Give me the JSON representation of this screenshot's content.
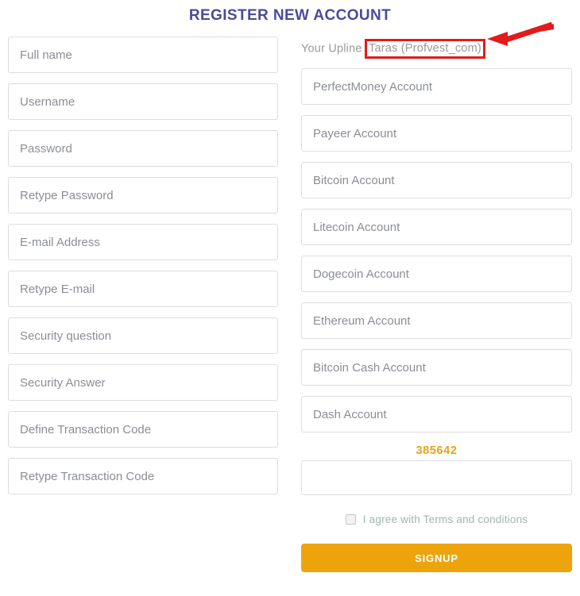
{
  "page": {
    "title": "REGISTER NEW ACCOUNT"
  },
  "upline": {
    "label": "Your Upline",
    "value": "Taras (Profvest_com)"
  },
  "annotation": {
    "arrow_color": "#e21b1b",
    "highlight_box_color": "#e21b1b"
  },
  "personal_fields": [
    {
      "name": "full-name",
      "placeholder": "Full name",
      "value": ""
    },
    {
      "name": "username",
      "placeholder": "Username",
      "value": ""
    },
    {
      "name": "password",
      "placeholder": "Password",
      "value": ""
    },
    {
      "name": "retype-password",
      "placeholder": "Retype Password",
      "value": ""
    },
    {
      "name": "email-address",
      "placeholder": "E-mail Address",
      "value": ""
    },
    {
      "name": "retype-email",
      "placeholder": "Retype E-mail",
      "value": ""
    },
    {
      "name": "security-question",
      "placeholder": "Security question",
      "value": ""
    },
    {
      "name": "security-answer",
      "placeholder": "Security Answer",
      "value": ""
    },
    {
      "name": "define-transaction-code",
      "placeholder": "Define Transaction Code",
      "value": ""
    },
    {
      "name": "retype-transaction-code",
      "placeholder": "Retype Transaction Code",
      "value": ""
    }
  ],
  "payment_fields": [
    {
      "name": "perfectmoney-account",
      "placeholder": "PerfectMoney Account",
      "value": ""
    },
    {
      "name": "payeer-account",
      "placeholder": "Payeer Account",
      "value": ""
    },
    {
      "name": "bitcoin-account",
      "placeholder": "Bitcoin Account",
      "value": ""
    },
    {
      "name": "litecoin-account",
      "placeholder": "Litecoin Account",
      "value": ""
    },
    {
      "name": "dogecoin-account",
      "placeholder": "Dogecoin Account",
      "value": ""
    },
    {
      "name": "ethereum-account",
      "placeholder": "Ethereum Account",
      "value": ""
    },
    {
      "name": "bitcoin-cash-account",
      "placeholder": "Bitcoin Cash Account",
      "value": ""
    },
    {
      "name": "dash-account",
      "placeholder": "Dash Account",
      "value": ""
    }
  ],
  "captcha": {
    "code": "385642",
    "input_placeholder": "",
    "input_value": "",
    "code_color": "#e8a317"
  },
  "terms": {
    "checked": false,
    "text": "I agree with Terms and conditions",
    "link_label": "Terms and conditions"
  },
  "signup": {
    "label": "SIGNUP",
    "color": "#eda40c"
  }
}
